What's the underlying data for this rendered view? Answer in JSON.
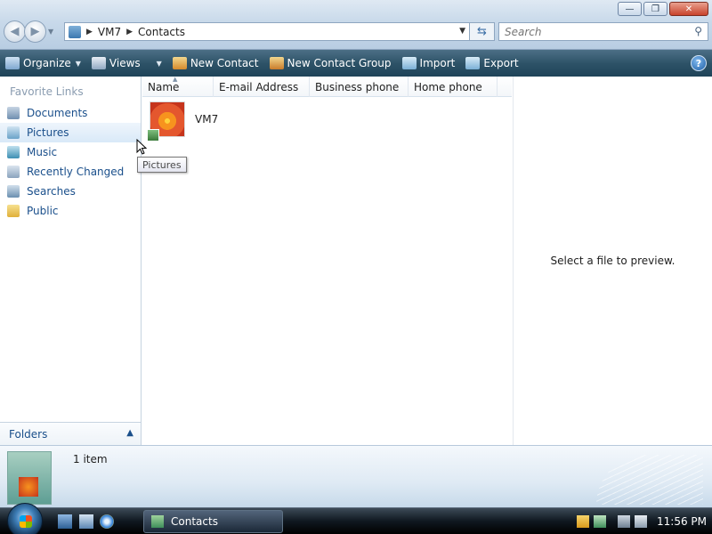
{
  "window": {
    "title_buttons": {
      "minimize": "—",
      "maximize": "❐",
      "close": "✕"
    }
  },
  "address": {
    "root": "VM7",
    "current": "Contacts"
  },
  "search": {
    "placeholder": "Search"
  },
  "toolbar": {
    "organize": "Organize",
    "views": "Views",
    "new_contact": "New Contact",
    "new_contact_group": "New Contact Group",
    "import": "Import",
    "export": "Export",
    "help": "?"
  },
  "nav": {
    "favorites_title": "Favorite Links",
    "items": [
      {
        "label": "Documents",
        "icon": "documents-icon",
        "color": "#6f8fb0"
      },
      {
        "label": "Pictures",
        "icon": "pictures-icon",
        "color": "#6aa3c9"
      },
      {
        "label": "Music",
        "icon": "music-icon",
        "color": "#3d8fb3"
      },
      {
        "label": "Recently Changed",
        "icon": "recent-icon",
        "color": "#8aa3bd"
      },
      {
        "label": "Searches",
        "icon": "searches-icon",
        "color": "#6a8fb0"
      },
      {
        "label": "Public",
        "icon": "public-folder-icon",
        "color": "#e7c14b"
      }
    ],
    "folders_label": "Folders"
  },
  "columns": [
    "Name",
    "E-mail Address",
    "Business phone",
    "Home phone"
  ],
  "contacts": [
    {
      "name": "VM7"
    }
  ],
  "tooltip": "Pictures",
  "preview": {
    "text": "Select a file to preview."
  },
  "details": {
    "count": "1 item"
  },
  "taskbar": {
    "task": "Contacts",
    "clock": "11:56 PM"
  },
  "colors": {
    "toolbar_bg": "#2e5368",
    "link": "#1a4f8b"
  }
}
